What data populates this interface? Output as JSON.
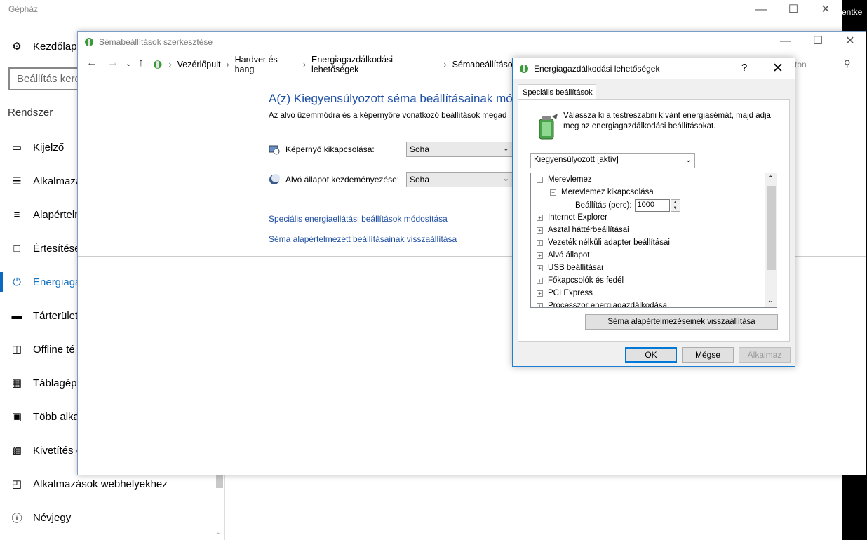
{
  "settings": {
    "title": "Gépház",
    "home_label": "Kezdőlap",
    "search_placeholder": "Beállítás kere",
    "section": "Rendszer",
    "nav": [
      {
        "label": "Kijelző",
        "icon": "monitor-icon"
      },
      {
        "label": "Alkalmazá",
        "icon": "apps-list-icon"
      },
      {
        "label": "Alapértelm",
        "icon": "default-apps-icon"
      },
      {
        "label": "Értesítése",
        "icon": "notification-icon"
      },
      {
        "label": "Energiaga",
        "icon": "power-icon",
        "active": true
      },
      {
        "label": "Tárterület",
        "icon": "storage-icon"
      },
      {
        "label": "Offline té",
        "icon": "map-icon"
      },
      {
        "label": "Táblagép",
        "icon": "tablet-icon"
      },
      {
        "label": "Több alka",
        "icon": "multitask-icon"
      },
      {
        "label": "Kivetítés e",
        "icon": "project-icon"
      },
      {
        "label": "Alkalmazások webhelyekhez",
        "icon": "web-apps-icon"
      },
      {
        "label": "Névjegy",
        "icon": "info-icon"
      }
    ],
    "right_edge_text": "entke"
  },
  "control_panel": {
    "title": "Sémabeállítások szerkesztése",
    "breadcrumb": [
      "Vezérlőpult",
      "Hardver és hang",
      "Energiagazdálkodási lehetőségek",
      "Sémabeállítások"
    ],
    "search_text": "ton",
    "heading": "A(z) Kiegyensúlyozott séma beállításainak módosít",
    "subheading": "Az alvó üzemmódra és a képernyőre vonatkozó beállítások megad",
    "display_off_label": "Képernyő kikapcsolása:",
    "display_off_value": "Soha",
    "sleep_label": "Alvó állapot kezdeményezése:",
    "sleep_value": "Soha",
    "link_advanced": "Speciális energiaellátási beállítások módosítása",
    "link_restore": "Séma alapértelmezett beállításainak visszaállítása"
  },
  "power_options": {
    "title": "Energiagazdálkodási lehetőségek",
    "help": "?",
    "tab": "Speciális beállítások",
    "description": "Válassza ki a testreszabni kívánt energiasémát, majd adja meg az energiagazdálkodási beállításokat.",
    "plan": "Kiegyensúlyozott [aktív]",
    "tree": {
      "hdd": "Merevlemez",
      "hdd_off": "Merevlemez kikapcsolása",
      "setting_label": "Beállítás (perc):",
      "setting_value": "1000",
      "items": [
        "Internet Explorer",
        "Asztal háttérbeállításai",
        "Vezeték nélküli adapter beállításai",
        "Alvó állapot",
        "USB beállításai",
        "Főkapcsolók és fedél",
        "PCI Express",
        "Processzor energiagazdálkodása"
      ]
    },
    "restore_button": "Séma alapértelmezéseinek visszaállítása",
    "ok": "OK",
    "cancel": "Mégse",
    "apply": "Alkalmaz"
  }
}
